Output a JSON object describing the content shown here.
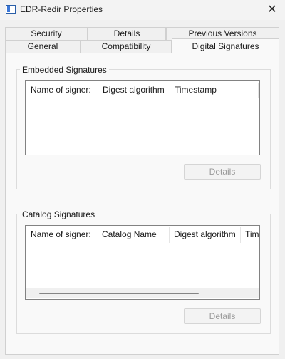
{
  "window": {
    "title": "EDR-Redir Properties",
    "close_glyph": "✕",
    "icon": "properties-window-icon"
  },
  "tabs_row1": [
    {
      "label": "Security"
    },
    {
      "label": "Details"
    },
    {
      "label": "Previous Versions"
    }
  ],
  "tabs_row2": [
    {
      "label": "General"
    },
    {
      "label": "Compatibility"
    },
    {
      "label": "Digital Signatures",
      "active": true
    }
  ],
  "embedded": {
    "label": "Embedded Signatures",
    "columns": [
      "Name of signer:",
      "Digest algorithm",
      "Timestamp"
    ],
    "details_label": "Details"
  },
  "catalog": {
    "label": "Catalog Signatures",
    "columns": [
      "Name of signer:",
      "Catalog Name",
      "Digest algorithm",
      "Timestamp"
    ],
    "details_label": "Details"
  }
}
